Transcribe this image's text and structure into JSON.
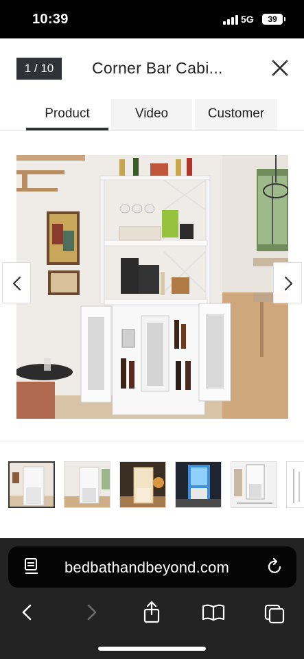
{
  "status_bar": {
    "time": "10:39",
    "network": "5G",
    "battery": "39"
  },
  "header": {
    "counter": "1 / 10",
    "title": "Corner Bar Cabi..."
  },
  "tabs": [
    {
      "label": "Product",
      "active": true
    },
    {
      "label": "Video",
      "active": false
    },
    {
      "label": "Customer",
      "active": false
    }
  ],
  "gallery": {
    "current_index": 1,
    "total": 10,
    "main_image": "corner-bar-cabinet-white-product-photo",
    "thumbnails": [
      {
        "image": "cabinet-white-room",
        "active": true
      },
      {
        "image": "cabinet-white-kitchen",
        "active": false
      },
      {
        "image": "cabinet-warm-lit",
        "active": false
      },
      {
        "image": "cabinet-led-blue",
        "active": false
      },
      {
        "image": "cabinet-dimensions",
        "active": false
      },
      {
        "image": "cabinet-diagram",
        "active": false
      }
    ]
  },
  "browser": {
    "url": "bedbathandbeyond.com",
    "toolbar": [
      "back-icon",
      "forward-icon",
      "share-icon",
      "bookmarks-icon",
      "tabs-icon"
    ]
  }
}
